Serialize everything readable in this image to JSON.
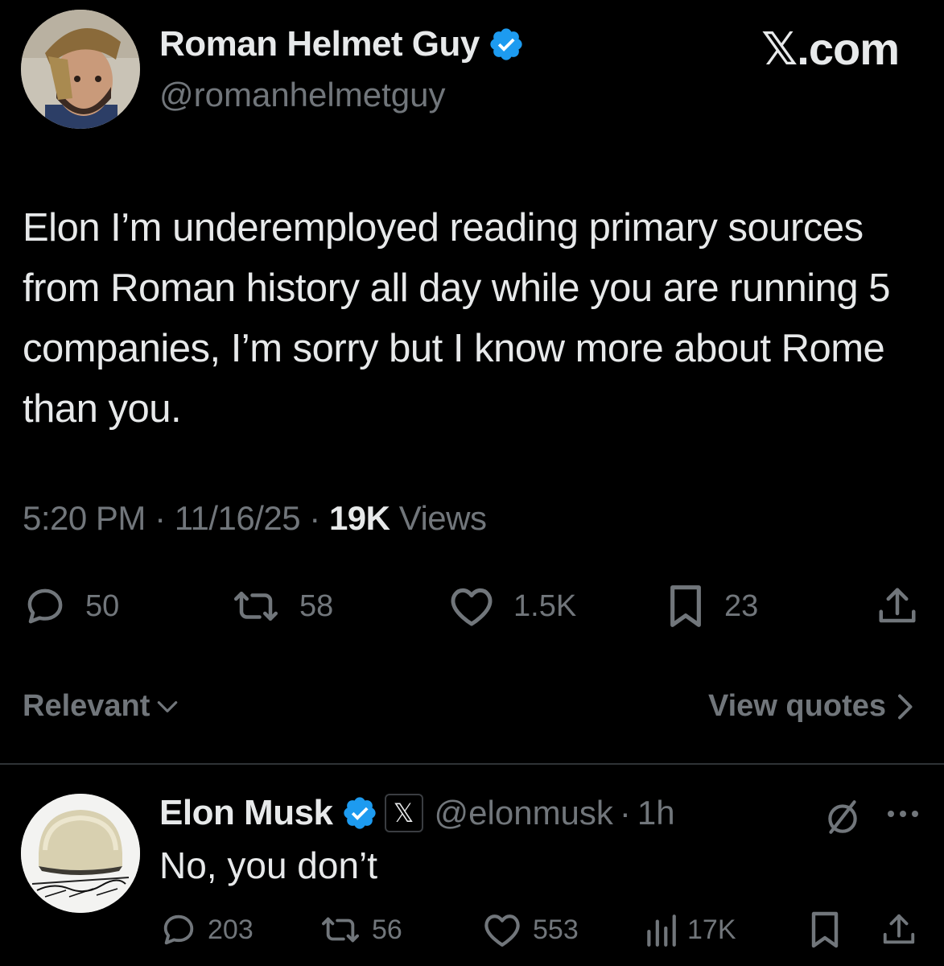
{
  "watermark": "𝕏.com",
  "tweet": {
    "author_name": "Roman Helmet Guy",
    "author_handle": "@romanhelmetguy",
    "text": "Elon I’m underemployed reading primary sources from Roman history all day while you are running 5 companies, I’m sorry but I know more about Rome than you.",
    "time": "5:20 PM",
    "date": "11/16/25",
    "views_count": "19K",
    "views_label": "Views",
    "stats": {
      "replies": "50",
      "reposts": "58",
      "likes": "1.5K",
      "bookmarks": "23"
    }
  },
  "sort": {
    "label": "Relevant"
  },
  "view_quotes": {
    "label": "View quotes"
  },
  "reply": {
    "author_name": "Elon Musk",
    "affiliation_badge": "𝕏",
    "author_handle": "@elonmusk",
    "age": "1h",
    "text": "No, you don’t",
    "stats": {
      "replies": "203",
      "reposts": "56",
      "likes": "553",
      "views": "17K"
    }
  },
  "colors": {
    "background": "#000000",
    "text_primary": "#e7e9ea",
    "text_secondary": "#71767b",
    "verified_blue": "#1d9bf0",
    "divider": "#2f3336"
  }
}
